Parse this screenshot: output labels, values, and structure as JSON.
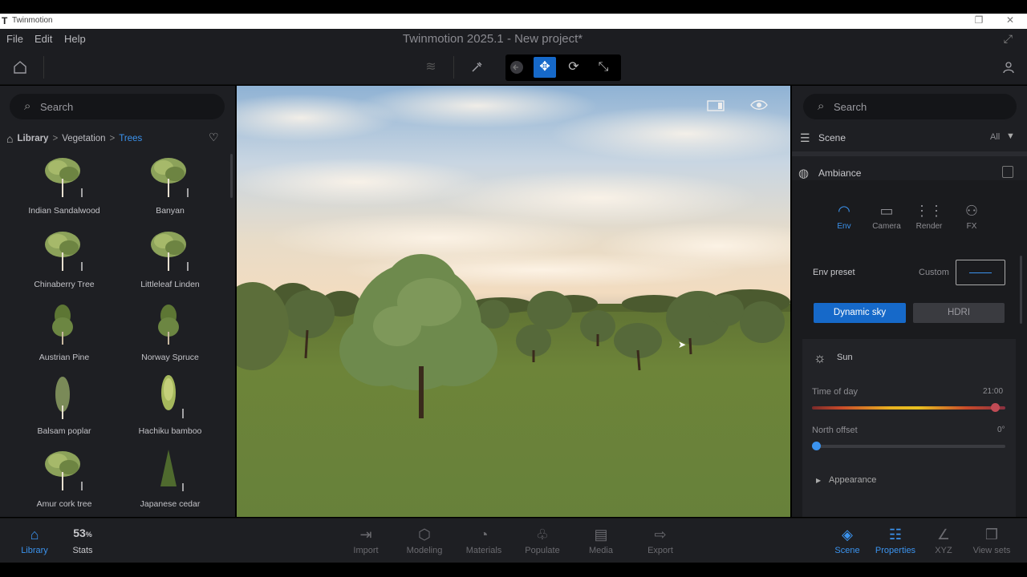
{
  "os_window": {
    "title": "Twinmotion",
    "logo": "T"
  },
  "menu": {
    "items": [
      "File",
      "Edit",
      "Help"
    ],
    "app_title": "Twinmotion 2025.1 - New project*"
  },
  "left": {
    "search_placeholder": "Search",
    "breadcrumb": [
      "Library",
      "Vegetation",
      "Trees"
    ],
    "items": [
      {
        "label": "Indian Sandalwood",
        "icon": "round-tree-icon"
      },
      {
        "label": "Banyan",
        "icon": "round-tree-icon"
      },
      {
        "label": "Chinaberry Tree",
        "icon": "round-tree-icon"
      },
      {
        "label": "Littleleaf Linden",
        "icon": "round-tree-icon"
      },
      {
        "label": "Austrian Pine",
        "icon": "pine-tree-icon"
      },
      {
        "label": "Norway Spruce",
        "icon": "pine-tree-icon"
      },
      {
        "label": "Balsam poplar",
        "icon": "poplar-tree-icon"
      },
      {
        "label": "Hachiku bamboo",
        "icon": "bamboo-icon"
      },
      {
        "label": "Amur cork tree",
        "icon": "round-tree-icon"
      },
      {
        "label": "Japanese cedar",
        "icon": "cedar-tree-icon"
      }
    ]
  },
  "right": {
    "search_placeholder": "Search",
    "scene_label": "Scene",
    "scene_filter": "All",
    "ambiance_label": "Ambiance",
    "tabs": [
      {
        "label": "Env",
        "icon": "env-dome-icon",
        "active": true
      },
      {
        "label": "Camera",
        "icon": "camera-icon",
        "active": false
      },
      {
        "label": "Render",
        "icon": "render-dots-icon",
        "active": false
      },
      {
        "label": "FX",
        "icon": "fx-icon",
        "active": false
      }
    ],
    "env_preset_label": "Env preset",
    "env_preset_value": "Custom",
    "sky_buttons": {
      "dynamic": "Dynamic sky",
      "hdri": "HDRI"
    },
    "sun_label": "Sun",
    "time_of_day": {
      "label": "Time of day",
      "value": "21:00",
      "fraction": 0.97
    },
    "north_offset": {
      "label": "North offset",
      "value": "0°",
      "fraction": 0.0
    },
    "appearance_label": "Appearance"
  },
  "bottom": {
    "left_items": [
      {
        "label": "Library",
        "active": true,
        "icon": "library-icon"
      },
      {
        "label": "Stats",
        "active": false,
        "icon": "stats-icon",
        "value": "53",
        "unit": "%"
      }
    ],
    "center_items": [
      {
        "label": "Import",
        "icon": "import-icon"
      },
      {
        "label": "Modeling",
        "icon": "modeling-icon"
      },
      {
        "label": "Materials",
        "icon": "materials-icon"
      },
      {
        "label": "Populate",
        "icon": "populate-icon"
      },
      {
        "label": "Media",
        "icon": "media-icon"
      },
      {
        "label": "Export",
        "icon": "export-icon"
      }
    ],
    "right_items": [
      {
        "label": "Scene",
        "active": true,
        "icon": "scene-layers-icon"
      },
      {
        "label": "Properties",
        "active": true,
        "icon": "properties-icon"
      },
      {
        "label": "XYZ",
        "active": false,
        "icon": "xyz-icon"
      },
      {
        "label": "View sets",
        "active": false,
        "icon": "view-sets-icon"
      }
    ]
  },
  "colors": {
    "accent": "#1669c9",
    "accent_text": "#3b93ee",
    "panel": "#1e1f23",
    "background": "#000000"
  }
}
